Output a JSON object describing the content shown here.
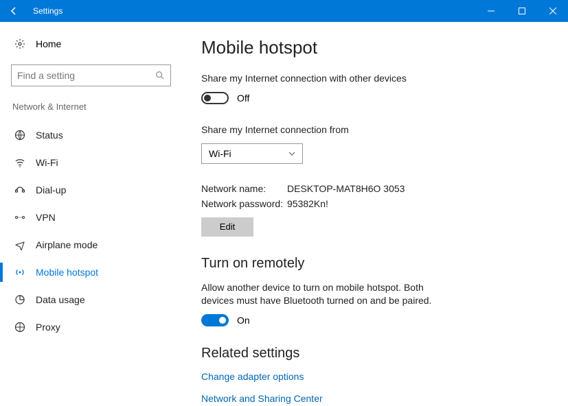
{
  "window": {
    "title": "Settings"
  },
  "sidebar": {
    "home": "Home",
    "search_placeholder": "Find a setting",
    "category": "Network & Internet",
    "items": [
      {
        "label": "Status"
      },
      {
        "label": "Wi-Fi"
      },
      {
        "label": "Dial-up"
      },
      {
        "label": "VPN"
      },
      {
        "label": "Airplane mode"
      },
      {
        "label": "Mobile hotspot"
      },
      {
        "label": "Data usage"
      },
      {
        "label": "Proxy"
      }
    ]
  },
  "page": {
    "title": "Mobile hotspot",
    "share_desc": "Share my Internet connection with other devices",
    "share_toggle": "Off",
    "share_from_label": "Share my Internet connection from",
    "share_from_value": "Wi-Fi",
    "network_name_label": "Network name:",
    "network_name_value": "DESKTOP-MAT8H6O 3053",
    "network_pass_label": "Network password:",
    "network_pass_value": "95382Kn!",
    "edit_label": "Edit",
    "remote_heading": "Turn on remotely",
    "remote_desc": "Allow another device to turn on mobile hotspot. Both devices must have Bluetooth turned on and be paired.",
    "remote_toggle": "On",
    "related_heading": "Related settings",
    "link1": "Change adapter options",
    "link2": "Network and Sharing Center"
  }
}
